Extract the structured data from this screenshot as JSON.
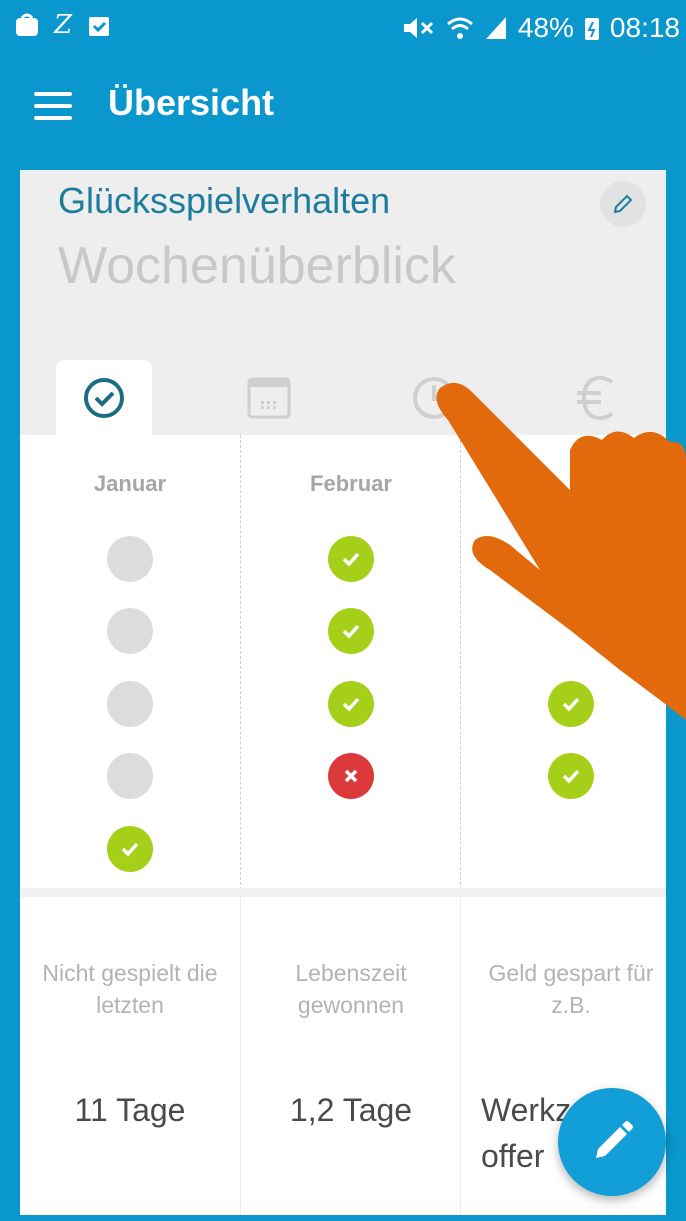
{
  "status_bar": {
    "left_icons": [
      "bag-icon",
      "zedge-icon",
      "clipboard-icon"
    ],
    "left_letter": "Z",
    "battery": "48%",
    "time": "08:18"
  },
  "app_bar": {
    "title": "Übersicht"
  },
  "header": {
    "title": "Glücksspielverhalten",
    "subtitle": "Wochenüberblick"
  },
  "tabs": [
    {
      "icon": "check-circle-icon",
      "active": true
    },
    {
      "icon": "calendar-icon",
      "active": false
    },
    {
      "icon": "clock-icon",
      "active": false
    },
    {
      "icon": "euro-icon",
      "active": false
    }
  ],
  "months": [
    {
      "label": "Januar",
      "days": [
        "empty",
        "empty",
        "empty",
        "empty",
        "ok"
      ]
    },
    {
      "label": "Februar",
      "days": [
        "ok",
        "ok",
        "ok",
        "bad"
      ]
    },
    {
      "label": "",
      "days": [
        "ok",
        "ok"
      ]
    }
  ],
  "stats": [
    {
      "label": "Nicht gespielt die letzten",
      "value": "11 Tage"
    },
    {
      "label": "Lebenszeit gewonnen",
      "value": "1,2 Tage"
    },
    {
      "label": "Geld gespart für z.B.",
      "value": "Werkz   k offer"
    }
  ],
  "colors": {
    "primary": "#0a97cd",
    "ok": "#a6cf1a",
    "bad": "#dc3a3a",
    "hand": "#e2690c"
  }
}
